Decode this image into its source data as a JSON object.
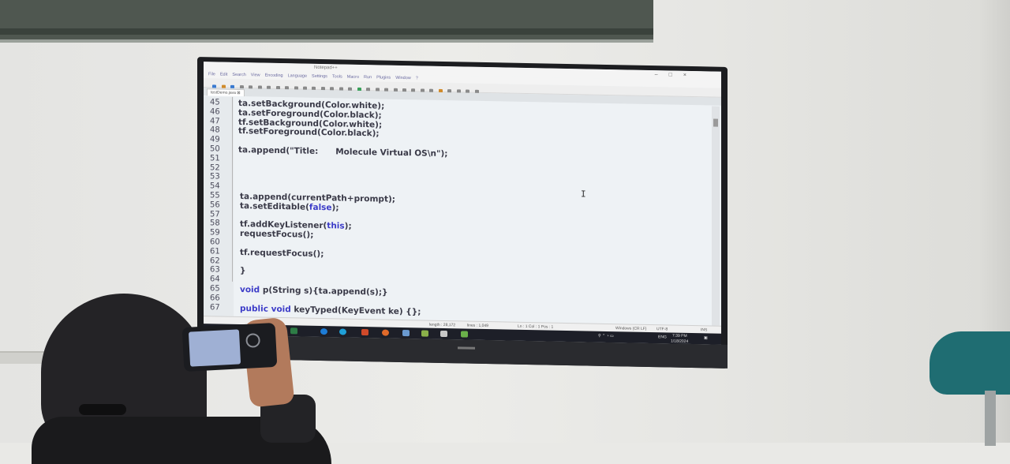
{
  "window": {
    "title": "Notepad++",
    "menu": [
      "File",
      "Edit",
      "Search",
      "View",
      "Encoding",
      "Language",
      "Settings",
      "Tools",
      "Macro",
      "Run",
      "Plugins",
      "Window",
      "?"
    ],
    "tab_label": "testDemo.java"
  },
  "editor": {
    "lines": [
      {
        "n": "45",
        "t": "ta.setBackground(Color.white);"
      },
      {
        "n": "46",
        "t": "ta.setForeground(Color.black);"
      },
      {
        "n": "47",
        "t": "tf.setBackground(Color.white);"
      },
      {
        "n": "48",
        "t": "tf.setForeground(Color.black);"
      },
      {
        "n": "49",
        "t": ""
      },
      {
        "n": "50",
        "t": "ta.append(\"Title:      Molecule Virtual OS\\n\");"
      },
      {
        "n": "51",
        "t": ""
      },
      {
        "n": "52",
        "t": ""
      },
      {
        "n": "53",
        "t": ""
      },
      {
        "n": "54",
        "t": ""
      },
      {
        "n": "55",
        "t": "ta.append(currentPath+prompt);"
      },
      {
        "n": "56",
        "t": "ta.setEditable(false);"
      },
      {
        "n": "57",
        "t": ""
      },
      {
        "n": "58",
        "t": "tf.addKeyListener(this);"
      },
      {
        "n": "59",
        "t": "requestFocus();"
      },
      {
        "n": "60",
        "t": ""
      },
      {
        "n": "61",
        "t": "tf.requestFocus();"
      },
      {
        "n": "62",
        "t": ""
      },
      {
        "n": "63",
        "t": "}"
      },
      {
        "n": "64",
        "t": ""
      },
      {
        "n": "65",
        "t": "void p(String s){ta.append(s);}"
      },
      {
        "n": "66",
        "t": ""
      },
      {
        "n": "67",
        "t": "public void keyTyped(KeyEvent ke) {};"
      }
    ]
  },
  "statusbar": {
    "length": "length : 28,172",
    "lines": "lines : 1,049",
    "position": "Ln : 1   Col : 1   Pos : 1",
    "eol": "Windows (CR LF)",
    "encoding": "UTF-8",
    "mode": "INS"
  },
  "taskbar": {
    "language": "ENG",
    "time": "7:39 PM",
    "date": "1/18/2024"
  },
  "colors": {
    "keyword": "#3c3cc8",
    "editor_bg": "#eef2f5",
    "taskbar_bg": "#1d1f28"
  }
}
